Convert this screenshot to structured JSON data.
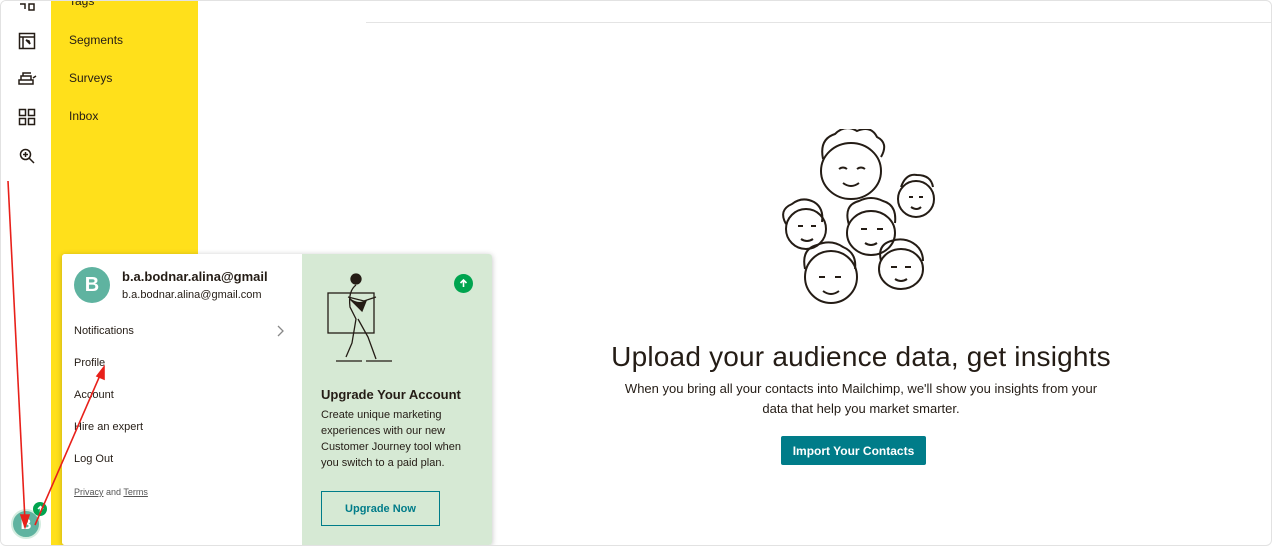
{
  "nav": {
    "items": [
      {
        "label": "Tags"
      },
      {
        "label": "Segments"
      },
      {
        "label": "Surveys"
      },
      {
        "label": "Inbox"
      }
    ]
  },
  "rail_icons": [
    "integrations-icon",
    "website-icon",
    "automations-icon",
    "grid-icon",
    "search-icon"
  ],
  "main": {
    "headline": "Upload your audience data, get insights",
    "subtext_line1": "When you bring all your contacts into Mailchimp, we'll show you insights from your",
    "subtext_line2": "data that help you market smarter.",
    "import_button": "Import Your Contacts"
  },
  "account_menu": {
    "avatar_letter": "B",
    "name": "b.a.bodnar.alina@gmail",
    "email": "b.a.bodnar.alina@gmail.com",
    "items": [
      {
        "label": "Notifications"
      },
      {
        "label": "Profile"
      },
      {
        "label": "Account"
      },
      {
        "label": "Hire an expert"
      },
      {
        "label": "Log Out"
      }
    ],
    "privacy": "Privacy",
    "and": "and",
    "terms": "Terms"
  },
  "upgrade": {
    "title": "Upgrade Your Account",
    "description": "Create unique marketing experiences with our new Customer Journey tool when you switch to a paid plan.",
    "button": "Upgrade Now"
  },
  "user_avatar": {
    "letter": "B"
  },
  "colors": {
    "nav_yellow": "#ffe01b",
    "teal": "#007c89",
    "green_badge": "#00a44f",
    "upgrade_bg": "#d6e9d4",
    "annotation_red": "#e8201a"
  }
}
